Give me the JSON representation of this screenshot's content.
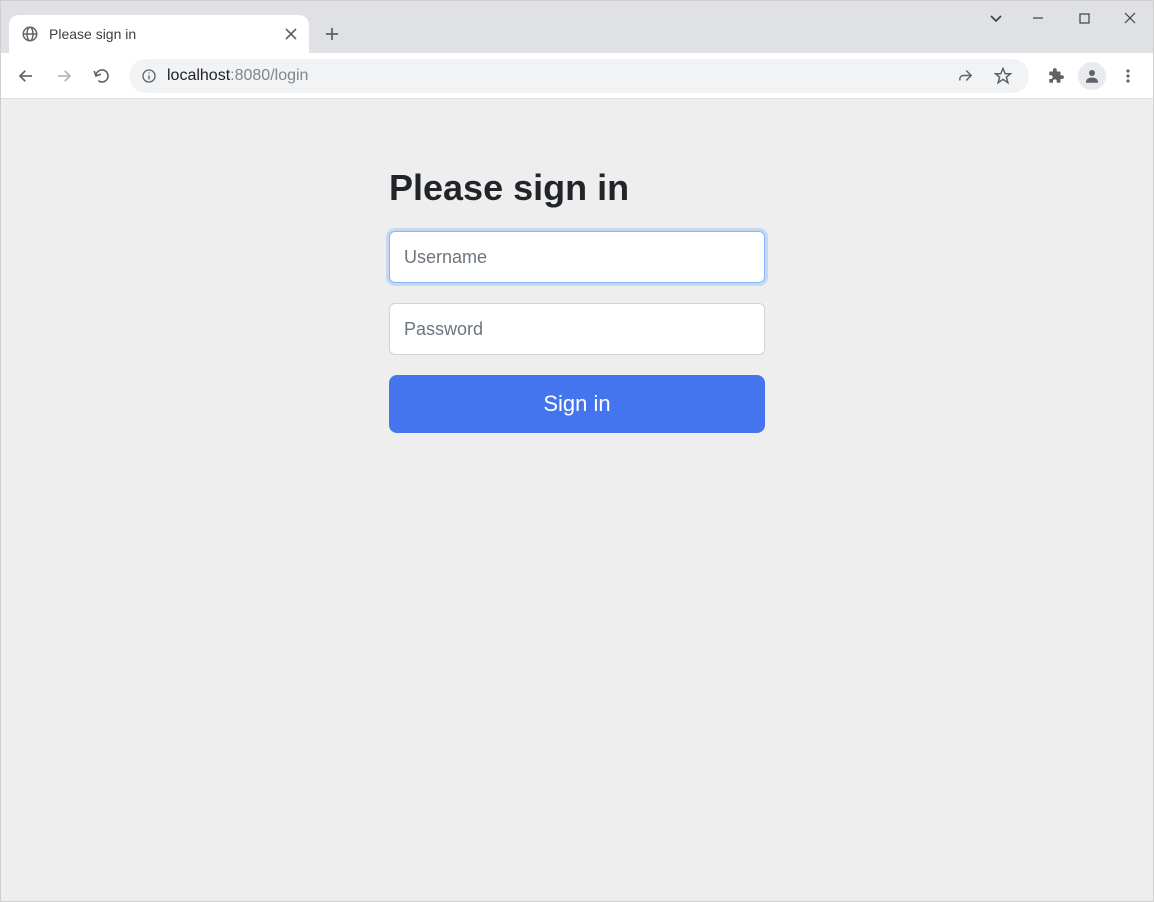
{
  "browser": {
    "tab_title": "Please sign in",
    "url_host": "localhost",
    "url_port_path": ":8080/login"
  },
  "page": {
    "heading": "Please sign in",
    "username_placeholder": "Username",
    "password_placeholder": "Password",
    "submit_label": "Sign in"
  }
}
